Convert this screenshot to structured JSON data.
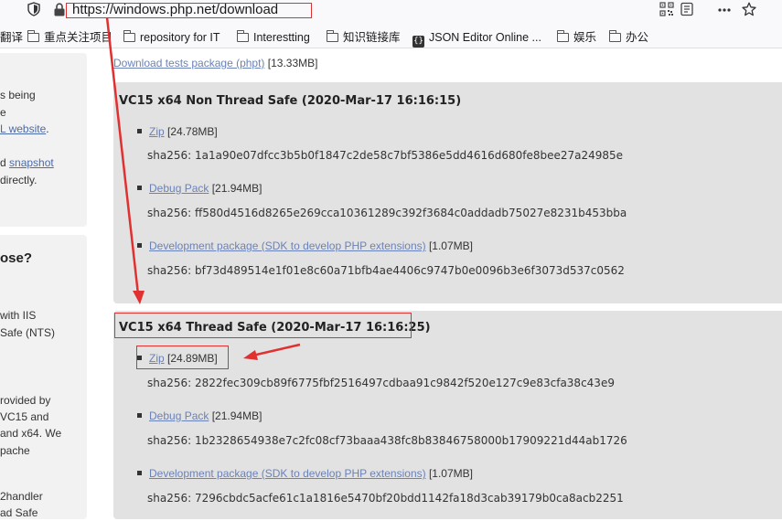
{
  "browser": {
    "url": "https://windows.php.net/download"
  },
  "bookmarks": [
    {
      "label": "翻译"
    },
    {
      "label": "重点关注项目"
    },
    {
      "label": "repository for IT"
    },
    {
      "label": "Interestting"
    },
    {
      "label": "知识链接库"
    },
    {
      "label": "JSON Editor Online ..."
    },
    {
      "label": "娱乐"
    },
    {
      "label": "办公"
    }
  ],
  "sidebar": {
    "box1": {
      "line1": "s being",
      "line2": "e",
      "line3_link": "L website",
      "line3_tail": ".",
      "line4_pre": "d",
      "line4_link": "snapshot",
      "line5": "directly."
    },
    "box2": {
      "heading": "ose?",
      "lines": [
        "with IIS",
        "Safe (NTS)",
        "rovided by",
        "VC15 and",
        "and x64. We",
        "pache",
        "2handler",
        "ad Safe"
      ]
    }
  },
  "main": {
    "tests_link": "Download tests package (phpt)",
    "tests_size": "[13.33MB]",
    "nts": {
      "title": "VC15 x64 Non Thread Safe (2020-Mar-17 16:16:15)",
      "items": [
        {
          "link": "Zip",
          "size": "[24.78MB]",
          "sha": "sha256: 1a1a90e07dfcc3b5b0f1847c2de58c7bf5386e5dd4616d680fe8bee27a24985e"
        },
        {
          "link": "Debug Pack",
          "size": "[21.94MB]",
          "sha": "sha256: ff580d4516d8265e269cca10361289c392f3684c0addadb75027e8231b453bba"
        },
        {
          "link": "Development package (SDK to develop PHP extensions)",
          "size": "[1.07MB]",
          "sha": "sha256: bf73d489514e1f01e8c60a71bfb4ae4406c9747b0e0096b3e6f3073d537c0562"
        }
      ]
    },
    "ts": {
      "title": "VC15 x64 Thread Safe (2020-Mar-17 16:16:25)",
      "items": [
        {
          "link": "Zip",
          "size": "[24.89MB]",
          "sha": "sha256: 2822fec309cb89f6775fbf2516497cdbaa91c9842f520e127c9e83cfa38c43e9"
        },
        {
          "link": "Debug Pack",
          "size": "[21.94MB]",
          "sha": "sha256: 1b2328654938e7c2fc08cf73baaa438fc8b83846758000b17909221d44ab1726"
        },
        {
          "link": "Development package (SDK to develop PHP extensions)",
          "size": "[1.07MB]",
          "sha": "sha256: 7296cbdc5acfe61c1a1816e5470bf20bdd1142fa18d3cab39179b0ca8acb2251"
        }
      ]
    }
  },
  "colors": {
    "annotation": "#e03030",
    "link": "#6b82b8",
    "panel": "#e2e2e2"
  }
}
